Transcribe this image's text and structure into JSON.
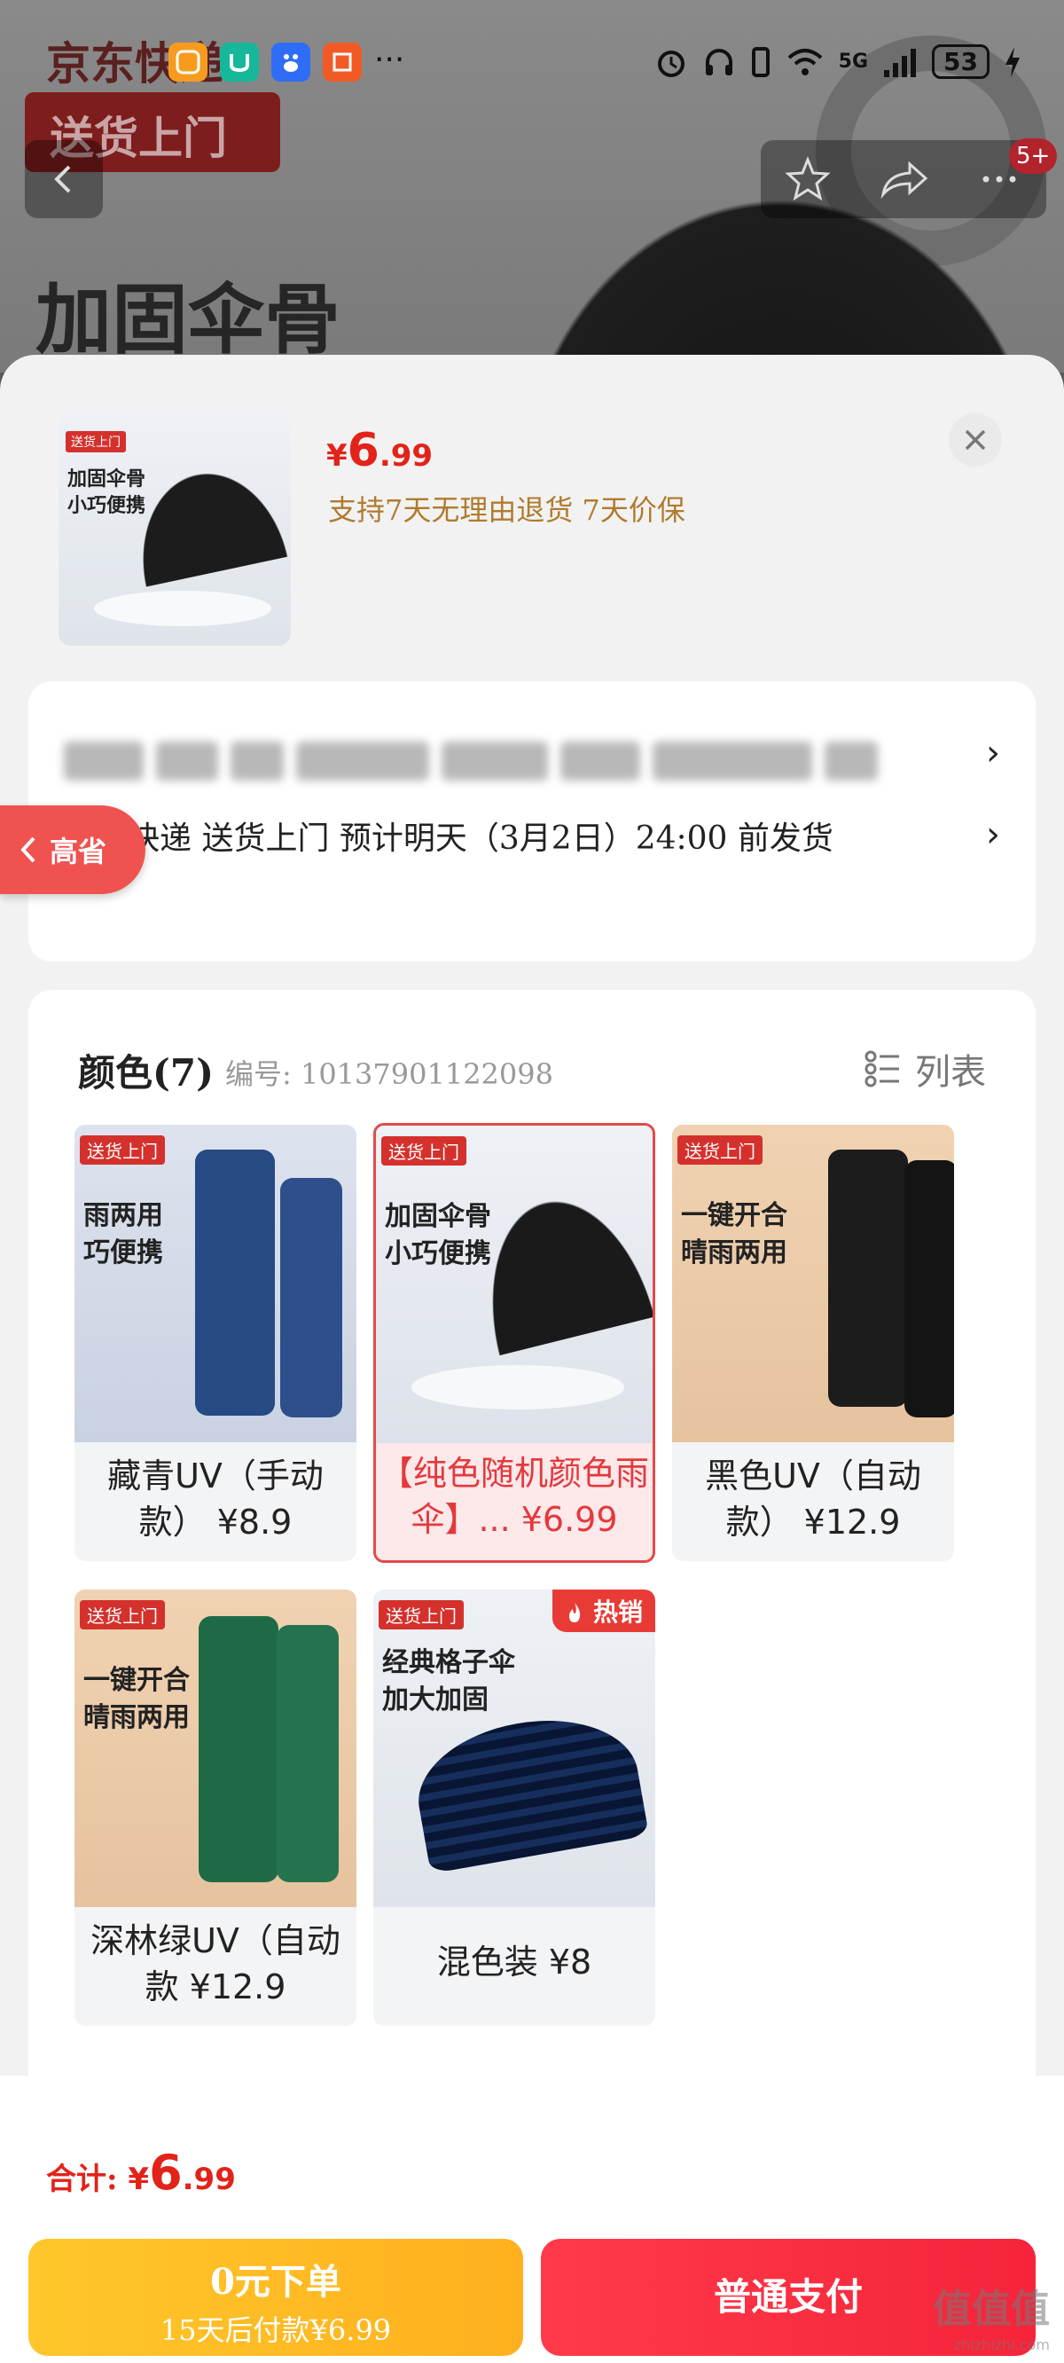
{
  "background": {
    "logo_text": "京东快递",
    "tag_text": "送货上门",
    "headline": "加固伞骨",
    "badge_count": "5+"
  },
  "status_bar": {
    "network": "5G",
    "battery": "53"
  },
  "product": {
    "price_currency": "¥",
    "price_int": "6",
    "price_dec": ".99",
    "policy": "支持7天无理由退货 7天价保",
    "thumb_tag": "送货上门",
    "thumb_line1": "加固伞骨",
    "thumb_line2": "小巧便携"
  },
  "delivery": {
    "text": "京东快递 送货上门 预计明天（3月2日）24:00 前发货"
  },
  "side_tab": {
    "label": "高省"
  },
  "color_section": {
    "title": "颜色(7)",
    "sku_code": "编号: 10137901122098",
    "list_label": "列表",
    "items": [
      {
        "label": "藏青UV（手动款） ¥8.9",
        "img_line1": "雨两用",
        "img_line2": "巧便携"
      },
      {
        "label": "【纯色随机颜色雨伞】... ¥6.99",
        "img_line1": "加固伞骨",
        "img_line2": "小巧便携"
      },
      {
        "label": "黑色UV（自动款） ¥12.9",
        "img_line1": "一键开合",
        "img_line2": "晴雨两用"
      },
      {
        "label": "深林绿UV（自动款 ¥12.9",
        "img_line1": "一键开合",
        "img_line2": "晴雨两用"
      },
      {
        "label": "混色装 ¥8",
        "img_line1": "经典格子伞",
        "img_line2": "加大加固",
        "badge": "热销"
      }
    ]
  },
  "bottom": {
    "total_label": "合计: ",
    "total_currency": "¥",
    "total_int": "6",
    "total_dec": ".99",
    "btn_zero_line1": "0元下单",
    "btn_zero_line2": "15天后付款¥6.99",
    "btn_pay": "普通支付",
    "watermark": "值值值",
    "watermark_url": "zhizhizhi.com"
  },
  "colors": {
    "accent_red": "#e2231a",
    "policy_gold": "#b07b2e",
    "btn_yellow": "#ffb01e",
    "btn_red": "#f5243a"
  }
}
